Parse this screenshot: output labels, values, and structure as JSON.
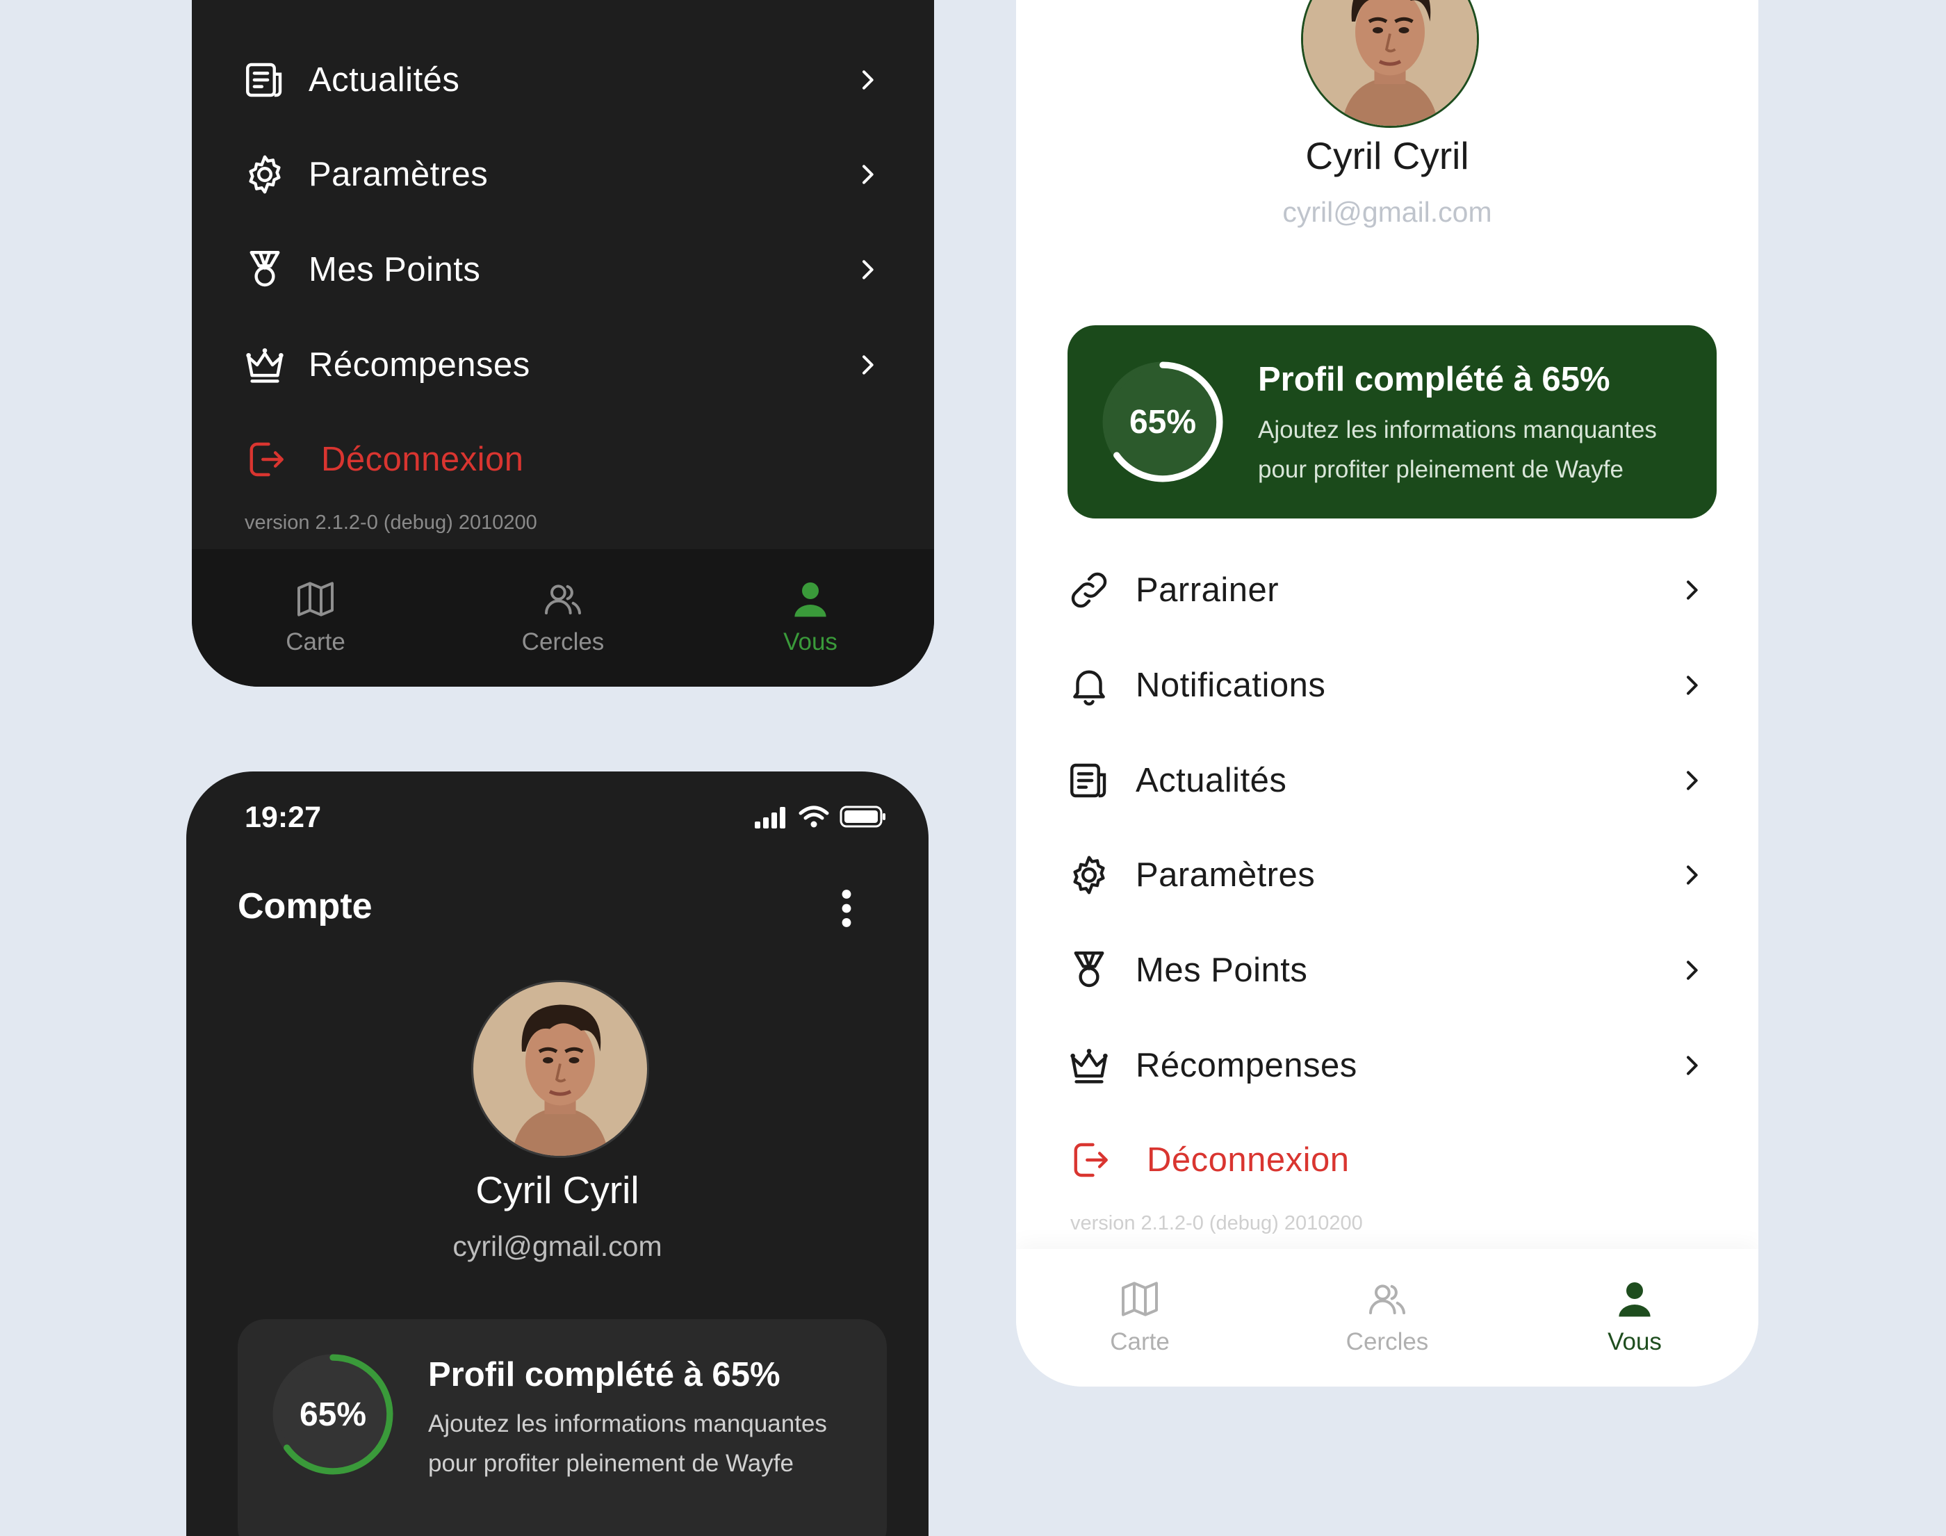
{
  "menu": {
    "parrainer": "Parrainer",
    "notifications": "Notifications",
    "actualites": "Actualités",
    "parametres": "Paramètres",
    "mes_points": "Mes Points",
    "recompenses": "Récompenses",
    "deconnexion": "Déconnexion"
  },
  "version": "version 2.1.2-0 (debug) 2010200",
  "tabs": {
    "carte": "Carte",
    "cercles": "Cercles",
    "vous": "Vous"
  },
  "profile": {
    "name": "Cyril Cyril",
    "email": "cyril@gmail.com"
  },
  "completion": {
    "percent": 0.65,
    "percent_label": "65%",
    "title": "Profil complété à 65%",
    "desc_line1": "Ajoutez les informations manquantes",
    "desc_line2": "pour profiter pleinement de Wayfe",
    "desc_line2_truncated": "pour profiter pleinement de Wayfe"
  },
  "status_bar": {
    "time": "19:27"
  },
  "header": {
    "title": "Compte"
  },
  "colors": {
    "accent_green": "#3a9a3a",
    "card_green": "#1b4a1b",
    "logout_red": "#d93530",
    "dark_bg": "#1e1e1e",
    "page_bg": "#e2e8f1"
  }
}
